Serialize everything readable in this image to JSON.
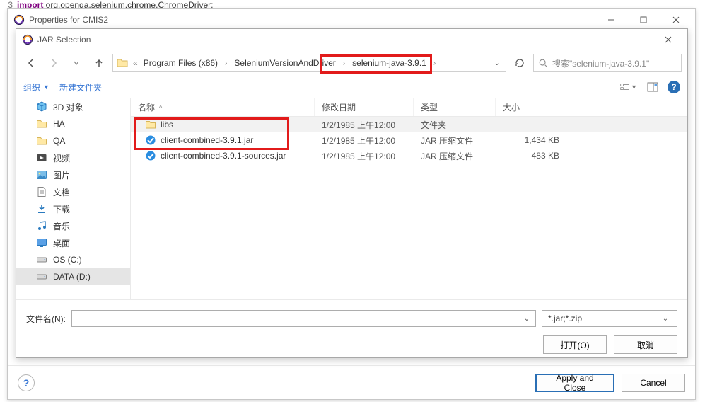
{
  "editor": {
    "line_no": "3",
    "keyword": "import",
    "rest": " org.openqa.selenium.chrome.ChromeDriver;"
  },
  "outer": {
    "title": "Properties for CMIS2",
    "apply_close": "Apply and Close",
    "cancel": "Cancel"
  },
  "inner": {
    "title": "JAR Selection",
    "breadcrumb": {
      "p1": "Program Files (x86)",
      "p2": "SeleniumVersionAndDriver",
      "p3": "selenium-java-3.9.1"
    },
    "search_placeholder": "搜索\"selenium-java-3.9.1\"",
    "toolbar": {
      "organize": "组织",
      "new_folder": "新建文件夹"
    },
    "sidebar": [
      {
        "label": "3D 对象",
        "icon": "cube3d"
      },
      {
        "label": "HA",
        "icon": "folder"
      },
      {
        "label": "QA",
        "icon": "folder"
      },
      {
        "label": "视频",
        "icon": "video"
      },
      {
        "label": "图片",
        "icon": "picture"
      },
      {
        "label": "文档",
        "icon": "document"
      },
      {
        "label": "下载",
        "icon": "download"
      },
      {
        "label": "音乐",
        "icon": "music"
      },
      {
        "label": "桌面",
        "icon": "desktop"
      },
      {
        "label": "OS (C:)",
        "icon": "drive"
      },
      {
        "label": "DATA (D:)",
        "icon": "drive"
      }
    ],
    "columns": {
      "name": "名称",
      "date": "修改日期",
      "type": "类型",
      "size": "大小"
    },
    "rows": [
      {
        "name": "libs",
        "date": "1/2/1985 上午12:00",
        "type": "文件夹",
        "size": "",
        "icon": "folder",
        "selected": true
      },
      {
        "name": "client-combined-3.9.1.jar",
        "date": "1/2/1985 上午12:00",
        "type": "JAR 压缩文件",
        "size": "1,434 KB",
        "icon": "jar",
        "selected": false
      },
      {
        "name": "client-combined-3.9.1-sources.jar",
        "date": "1/2/1985 上午12:00",
        "type": "JAR 压缩文件",
        "size": "483 KB",
        "icon": "jar",
        "selected": false
      }
    ],
    "fn_label_pre": "文件名(",
    "fn_label_u": "N",
    "fn_label_post": "):",
    "filter": "*.jar;*.zip",
    "open": "打开(O)",
    "cancel": "取消"
  }
}
